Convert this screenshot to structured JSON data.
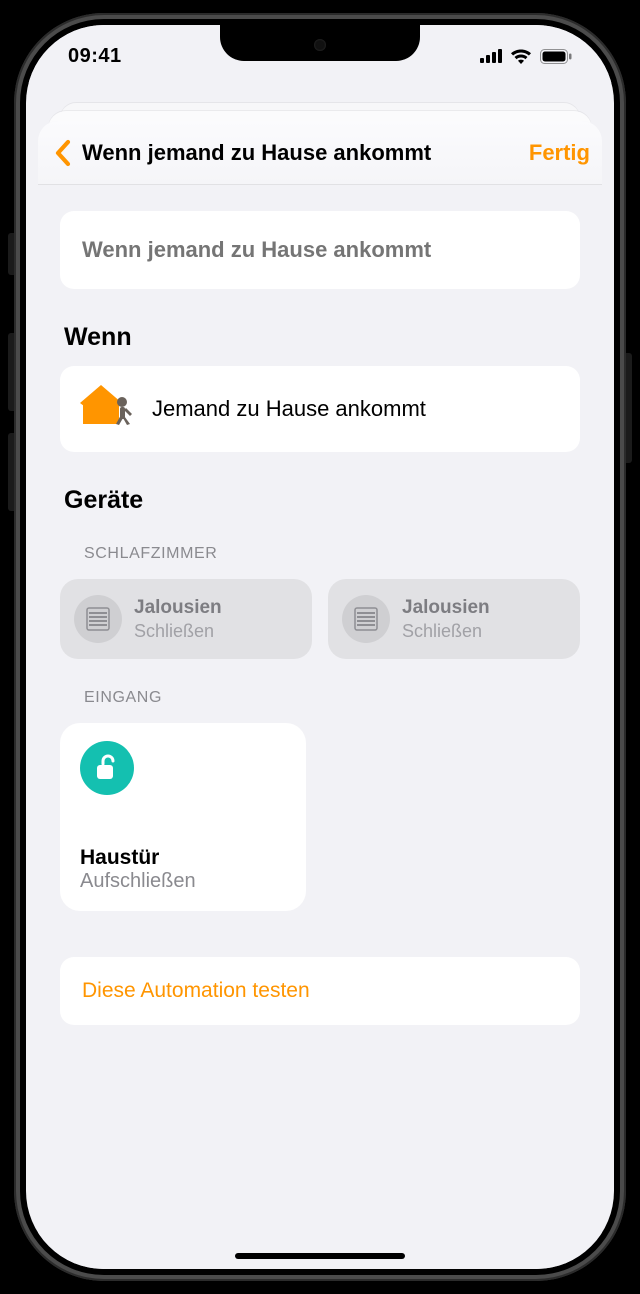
{
  "status": {
    "time": "09:41"
  },
  "nav": {
    "title": "Wenn jemand zu Hause ankommt",
    "done": "Fertig"
  },
  "name_field": {
    "placeholder": "Wenn jemand zu Hause ankommt"
  },
  "sections": {
    "when_header": "Wenn",
    "devices_header": "Geräte"
  },
  "when": {
    "label": "Jemand zu Hause ankommt"
  },
  "groups": {
    "bedroom": {
      "label": "SCHLAFZIMMER",
      "tiles": [
        {
          "title": "Jalousien",
          "state": "Schließen"
        },
        {
          "title": "Jalousien",
          "state": "Schließen"
        }
      ]
    },
    "entrance": {
      "label": "EINGANG",
      "tiles": [
        {
          "title": "Haustür",
          "state": "Aufschließen"
        }
      ]
    }
  },
  "action": {
    "test_label": "Diese Automation testen"
  },
  "colors": {
    "accent": "#ff9500",
    "teal": "#14c0b0"
  }
}
